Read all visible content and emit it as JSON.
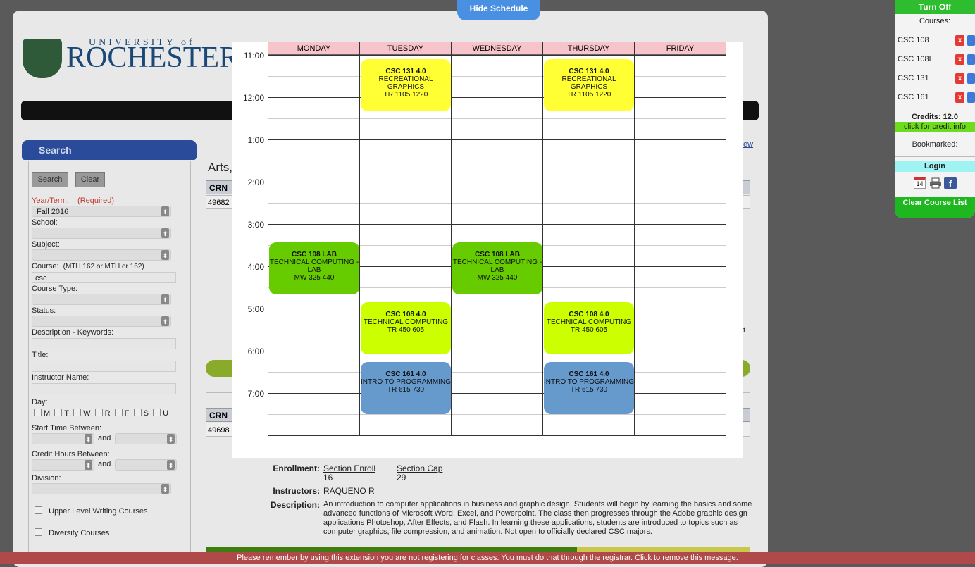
{
  "logo": {
    "university": "UNIVERSITY of",
    "name": "ROCHESTER"
  },
  "search": {
    "header": "Search",
    "search_btn": "Search",
    "clear_btn": "Clear",
    "year_term_label": "Year/Term:",
    "required": "(Required)",
    "year_term_value": "Fall 2016",
    "school_label": "School:",
    "subject_label": "Subject:",
    "course_label": "Course:",
    "course_hint": "(MTH 162 or MTH or 162)",
    "course_value": "csc",
    "course_type_label": "Course Type:",
    "status_label": "Status:",
    "desc_label": "Description - Keywords:",
    "title_label": "Title:",
    "instructor_label": "Instructor Name:",
    "day_label": "Day:",
    "days": [
      "M",
      "T",
      "W",
      "R",
      "F",
      "S",
      "U"
    ],
    "start_label": "Start Time Between:",
    "and": "and",
    "credit_label": "Credit Hours Between:",
    "division_label": "Division:",
    "upper_level": "Upper Level Writing Courses",
    "diversity": "Diversity Courses"
  },
  "background": {
    "arts": "Arts,",
    "crn_header": "CRN",
    "crn1": "49682",
    "crn2": "49698",
    "view_link": "ew",
    "t_char": "t",
    "enrollment_label": "Enrollment:",
    "section_enroll": "Section Enroll",
    "section_enroll_val": "16",
    "section_cap": "Section Cap",
    "section_cap_val": "29",
    "instructors_label": "Instructors:",
    "instructor": "RAQUENO R",
    "description_label": "Description:",
    "description": "An introduction to computer applications in business and graphic design. Students will begin by learning the basics and some advanced functions of Microsoft Word, Excel, and Powerpoint. The class then progresses through the Adobe graphic design applications Photoshop, After Effects, and Flash. In learning these applications, students are introduced to topics such as computer graphics, file compression, and animation. Not open to officially declared CSC majors."
  },
  "schedule": {
    "hide_button": "Hide Schedule",
    "days": [
      "MONDAY",
      "TUESDAY",
      "WEDNESDAY",
      "THURSDAY",
      "FRIDAY"
    ],
    "times": [
      "11:00",
      "12:00",
      "1:00",
      "2:00",
      "3:00",
      "4:00",
      "5:00",
      "6:00",
      "7:00"
    ],
    "events": [
      {
        "title": "CSC 131 4.0",
        "name": "RECREATIONAL GRAPHICS",
        "time": "TR 1105 1220",
        "color": "#ffff33"
      },
      {
        "title": "CSC 131 4.0",
        "name": "RECREATIONAL GRAPHICS",
        "time": "TR 1105 1220",
        "color": "#ffff33"
      },
      {
        "title": "CSC 108 LAB",
        "name": "TECHNICAL COMPUTING - LAB",
        "time": "MW 325 440",
        "color": "#66cc00"
      },
      {
        "title": "CSC 108 LAB",
        "name": "TECHNICAL COMPUTING - LAB",
        "time": "MW 325 440",
        "color": "#66cc00"
      },
      {
        "title": "CSC 108 4.0",
        "name": "TECHNICAL COMPUTING",
        "time": "TR 450 605",
        "color": "#ccff00"
      },
      {
        "title": "CSC 108 4.0",
        "name": "TECHNICAL COMPUTING",
        "time": "TR 450 605",
        "color": "#ccff00"
      },
      {
        "title": "CSC 161 4.0",
        "name": "INTRO TO PROGRAMMING",
        "time": "TR 615 730",
        "color": "#6699cc"
      },
      {
        "title": "CSC 161 4.0",
        "name": "INTRO TO PROGRAMMING",
        "time": "TR 615 730",
        "color": "#6699cc"
      }
    ]
  },
  "panel": {
    "turn_off": "Turn Off",
    "courses_label": "Courses:",
    "courses": [
      "CSC 108",
      "CSC 108L",
      "CSC 131",
      "CSC 161"
    ],
    "remove_glyph": "x",
    "move_glyph": "↓",
    "credits": "Credits: 12.0",
    "credit_info": "click for credit info",
    "bookmarked": "Bookmarked:",
    "login": "Login",
    "calendar_day": "14",
    "clear_list": "Clear Course List"
  },
  "footer": {
    "message": "Please remember by using this extension you are not registering for classes. You must do that through the registrar. Click to remove this message."
  }
}
